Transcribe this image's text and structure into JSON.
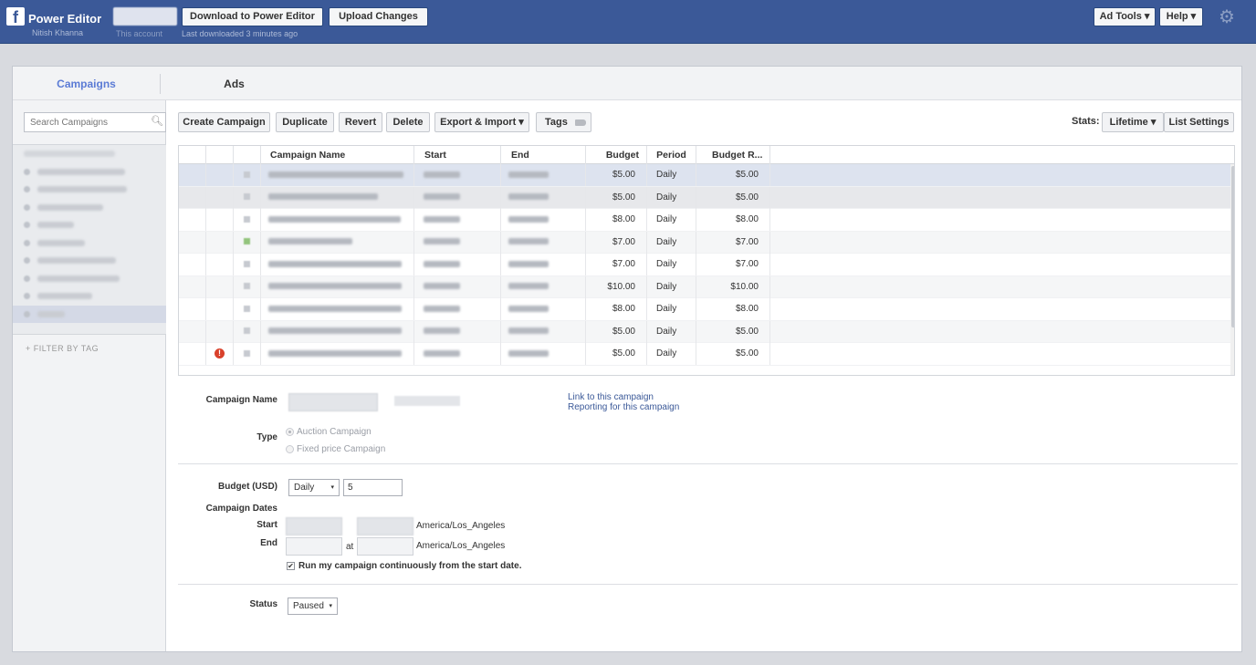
{
  "header": {
    "app_title": "Power Editor",
    "user_name": "Nitish Khanna",
    "account_label": "This account",
    "download_button": "Download to Power Editor",
    "upload_button": "Upload Changes",
    "last_downloaded": "Last downloaded 3 minutes ago",
    "ad_tools": "Ad Tools ▾",
    "help": "Help ▾",
    "logo_glyph": "f",
    "gear_glyph": "⚙"
  },
  "tabs": {
    "campaigns": "Campaigns",
    "ads": "Ads"
  },
  "sidebar": {
    "search_placeholder": "Search Campaigns",
    "filter_by_tag": "+ FILTER BY TAG"
  },
  "toolbar": {
    "create_campaign": "Create Campaign",
    "duplicate": "Duplicate",
    "revert": "Revert",
    "delete": "Delete",
    "export_import": "Export & Import ▾",
    "tags": "Tags",
    "stats_label": "Stats:",
    "lifetime": "Lifetime ▾",
    "list_settings": "List Settings"
  },
  "table": {
    "columns": [
      "Campaign Name",
      "Start",
      "End",
      "Budget",
      "Period",
      "Budget R..."
    ],
    "rows": [
      {
        "budget": "$5.00",
        "period": "Daily",
        "budget_r": "$5.00"
      },
      {
        "budget": "$5.00",
        "period": "Daily",
        "budget_r": "$5.00"
      },
      {
        "budget": "$8.00",
        "period": "Daily",
        "budget_r": "$8.00"
      },
      {
        "budget": "$7.00",
        "period": "Daily",
        "budget_r": "$7.00"
      },
      {
        "budget": "$7.00",
        "period": "Daily",
        "budget_r": "$7.00"
      },
      {
        "budget": "$10.00",
        "period": "Daily",
        "budget_r": "$10.00"
      },
      {
        "budget": "$8.00",
        "period": "Daily",
        "budget_r": "$8.00"
      },
      {
        "budget": "$5.00",
        "period": "Daily",
        "budget_r": "$5.00"
      },
      {
        "budget": "$5.00",
        "period": "Daily",
        "budget_r": "$5.00"
      }
    ],
    "error_glyph": "!"
  },
  "detail": {
    "campaign_name_label": "Campaign Name",
    "link_campaign": "Link to this campaign",
    "reporting_link": "Reporting for this campaign",
    "type_label": "Type",
    "auction": "Auction Campaign",
    "fixed_price": "Fixed price Campaign",
    "budget_label": "Budget (USD)",
    "budget_period": "Daily",
    "budget_value": "5",
    "campaign_dates_label": "Campaign Dates",
    "start_label": "Start",
    "end_label": "End",
    "timezone_start": "America/Los_Angeles",
    "timezone_end": "America/Los_Angeles",
    "at_label": "at",
    "run_continuously": "Run my campaign continuously from the start date.",
    "status_label": "Status",
    "status_value": "Paused",
    "caret": "▾"
  }
}
